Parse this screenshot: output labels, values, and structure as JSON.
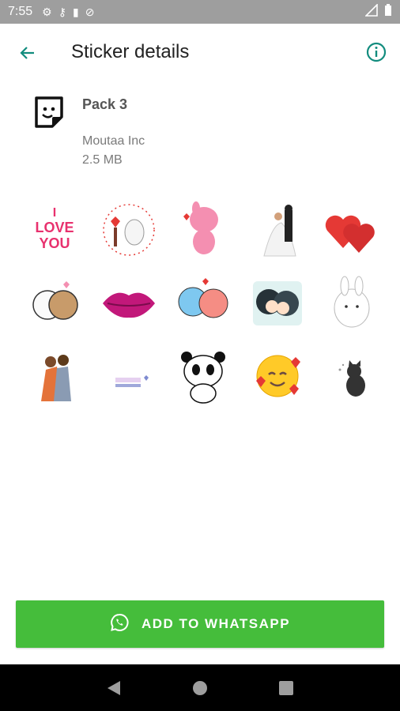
{
  "status_bar": {
    "time": "7:55",
    "left_icons": [
      "gear-icon",
      "key-icon",
      "sd-card-icon",
      "no-disturb-icon"
    ],
    "right_icons": [
      "signal-icon",
      "battery-icon"
    ]
  },
  "app_bar": {
    "title": "Sticker details",
    "back_icon": "arrow-back-icon",
    "info_icon": "info-icon",
    "accent_color": "#128c7e"
  },
  "pack": {
    "name": "Pack 3",
    "publisher": "Moutaa Inc",
    "size": "2.5 MB",
    "icon": "sticker-icon"
  },
  "stickers": [
    {
      "name": "i-love-you-sticker"
    },
    {
      "name": "bunny-hearts-sticker"
    },
    {
      "name": "pink-bunny-sticker"
    },
    {
      "name": "wedding-couple-sticker"
    },
    {
      "name": "red-hearts-sticker"
    },
    {
      "name": "hugging-bears-sticker"
    },
    {
      "name": "pink-lips-sticker"
    },
    {
      "name": "cute-animals-sticker"
    },
    {
      "name": "anime-kiss-sticker"
    },
    {
      "name": "white-bunny-sticker"
    },
    {
      "name": "couple-hug-sticker"
    },
    {
      "name": "small-sticker"
    },
    {
      "name": "panda-sticker"
    },
    {
      "name": "smiley-hearts-sticker"
    },
    {
      "name": "black-cat-sticker"
    }
  ],
  "add_button": {
    "label": "ADD TO WHATSAPP",
    "icon": "whatsapp-icon",
    "color": "#45bd3b"
  },
  "nav_bar": {
    "icons": [
      "back-triangle-icon",
      "home-circle-icon",
      "recents-square-icon"
    ]
  }
}
